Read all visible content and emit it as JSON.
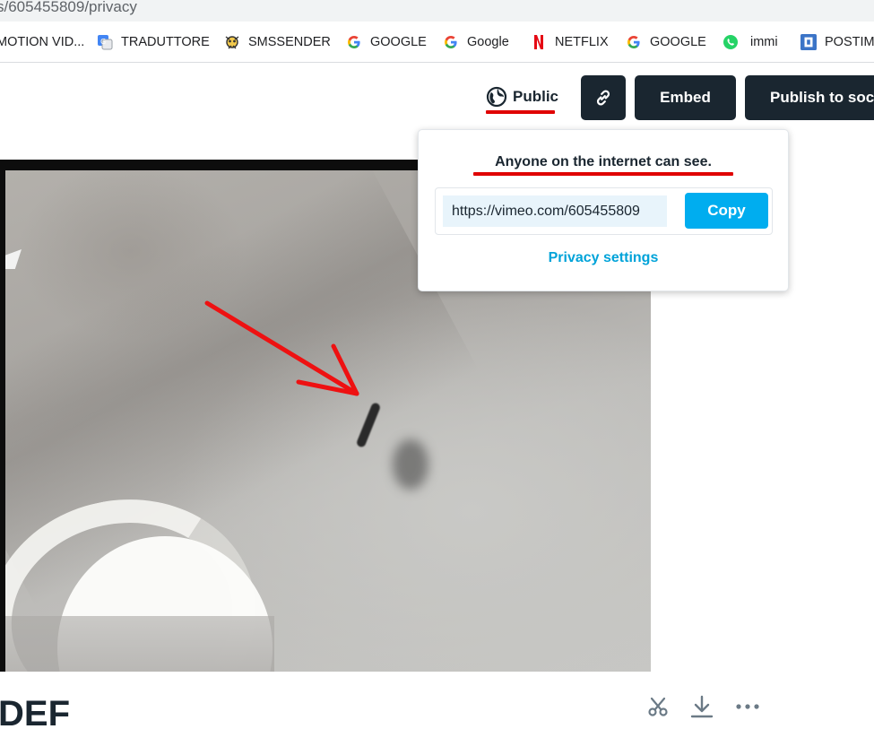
{
  "browser": {
    "url": "s/605455809/privacy",
    "bookmarks": [
      {
        "label": "MOTION VID...",
        "icon": "bookmark-icon"
      },
      {
        "label": "TRADUTTORE",
        "icon": "google-translate-icon"
      },
      {
        "label": "SMSSENDER",
        "icon": "smssender-icon"
      },
      {
        "label": "GOOGLE",
        "icon": "google-icon"
      },
      {
        "label": "Google",
        "icon": "google-icon"
      },
      {
        "label": "NETFLIX",
        "icon": "netflix-icon"
      },
      {
        "label": "GOOGLE",
        "icon": "google-icon"
      },
      {
        "label": "immi",
        "icon": "whatsapp-icon"
      },
      {
        "label": "POSTIM",
        "icon": "postimages-icon"
      }
    ]
  },
  "toolbar": {
    "privacy_label": "Public",
    "link_icon": "link-icon",
    "embed_label": "Embed",
    "publish_label": "Publish to soc"
  },
  "popover": {
    "title": "Anyone on the internet can see.",
    "link_value": "https://vimeo.com/605455809",
    "copy_label": "Copy",
    "privacy_settings_label": "Privacy settings"
  },
  "video": {
    "title": "DEF"
  },
  "actions": {
    "icons": [
      "scissors-icon",
      "download-icon",
      "more-icon"
    ]
  },
  "colors": {
    "dark": "#1a2630",
    "accent": "#00adef",
    "link": "#00a3d9",
    "annotation": "#e00000"
  }
}
